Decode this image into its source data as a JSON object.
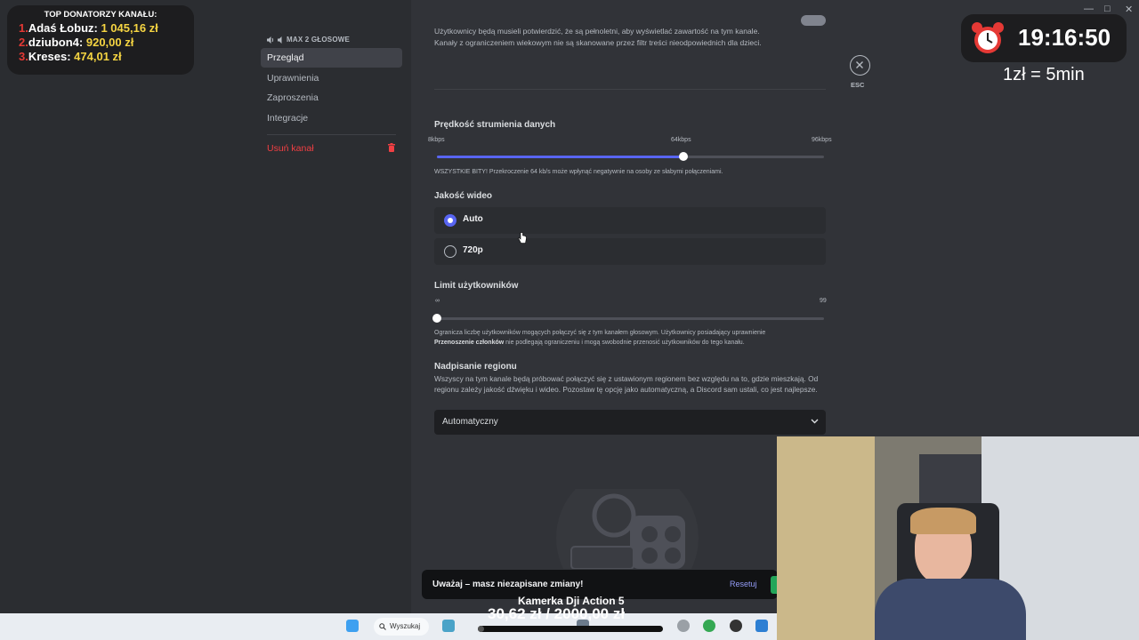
{
  "donors": {
    "title": "TOP DONATORZY KANAŁU:",
    "list": [
      {
        "rank": "1.",
        "name": "Adaś Łobuz:",
        "amount": "1 045,16 zł"
      },
      {
        "rank": "2.",
        "name": "dziubon4:",
        "amount": "920,00 zł"
      },
      {
        "rank": "3.",
        "name": "Kreses:",
        "amount": "474,01 zł"
      }
    ]
  },
  "sidebar": {
    "channel_header": "MAX 2 GŁOSOWE",
    "items": [
      {
        "label": "Przegląd",
        "active": true
      },
      {
        "label": "Uprawnienia"
      },
      {
        "label": "Zaproszenia"
      },
      {
        "label": "Integracje"
      }
    ],
    "delete_label": "Usuń kanał"
  },
  "settings": {
    "age_restricted_desc": "Użytkownicy będą musieli potwierdzić, że są pełnoletni, aby wyświetlać zawartość na tym kanale. Kanały z ograniczeniem wiekowym nie są skanowane przez filtr treści nieodpowiednich dla dzieci.",
    "bitrate": {
      "title": "Prędkość strumienia danych",
      "ticks": [
        "8kbps",
        "64kbps",
        "96kbps"
      ],
      "min": 8,
      "max": 96,
      "value": 64,
      "warning": "WSZYSTKIE BITY! Przekroczenie 64 kb/s może wpłynąć negatywnie na osoby ze słabymi połączeniami."
    },
    "video_quality": {
      "title": "Jakość wideo",
      "options": [
        {
          "label": "Auto",
          "selected": true
        },
        {
          "label": "720p",
          "selected": false
        }
      ]
    },
    "user_limit": {
      "title": "Limit użytkowników",
      "min_label": "∞",
      "max_label": "99",
      "value": 0,
      "desc_part1": "Ogranicza liczbę użytkowników mogących połączyć się z tym kanałem głosowym. Użytkownicy posiadający uprawnienie",
      "desc_bold": "Przenoszenie członków",
      "desc_part2": "nie podlegają ograniczeniu i mogą swobodnie przenosić użytkowników do tego kanału."
    },
    "region": {
      "title": "Nadpisanie regionu",
      "desc": "Wszyscy na tym kanale będą próbować połączyć się z ustawionym regionem bez względu na to, gdzie mieszkają. Od regionu zależy jakość dźwięku i wideo. Pozostaw tę opcję jako automatyczną, a Discord sam ustali, co jest najlepsze.",
      "selected": "Automatyczny"
    }
  },
  "close": {
    "esc_label": "ESC"
  },
  "overlay": {
    "time": "19:16:50",
    "rate": "1zł = 5min",
    "camera_label": "Kamerka Dji Action 5",
    "camera_amount": "30,62 zł / 2000,00 zł",
    "camera_progress": 0.0153
  },
  "unsaved_bar": {
    "message": "Uważaj – masz niezapisane zmiany!",
    "reset_label": "Resetuj"
  },
  "taskbar": {
    "search_label": "Wyszukaj"
  },
  "colors": {
    "accent": "#5865f2",
    "danger": "#f23f43",
    "success": "#23a559",
    "donor_amount": "#f5d442"
  }
}
